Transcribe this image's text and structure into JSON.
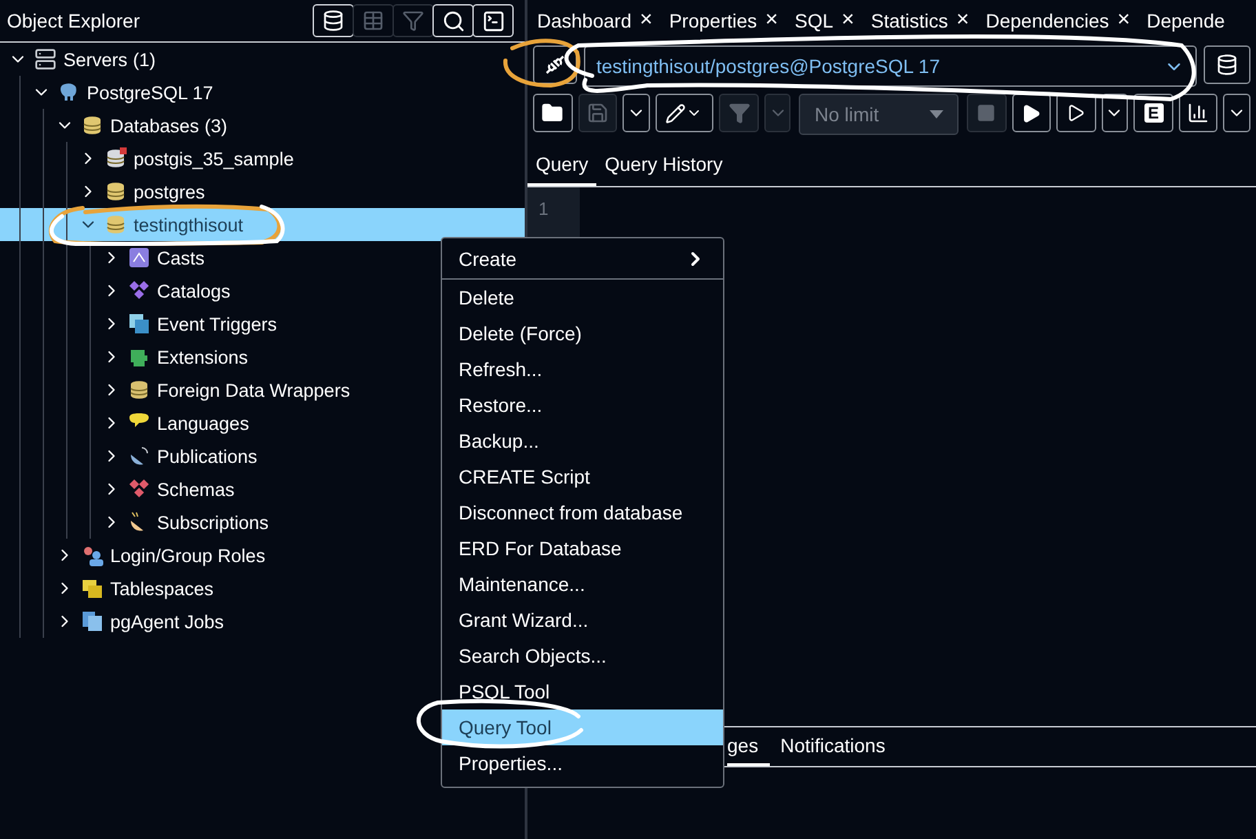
{
  "object_explorer": {
    "title": "Object Explorer",
    "tools": [
      {
        "kind": "query",
        "disabled": false
      },
      {
        "kind": "grid",
        "disabled": true
      },
      {
        "kind": "filter",
        "disabled": true
      },
      {
        "kind": "search",
        "disabled": false
      },
      {
        "kind": "terminal",
        "disabled": false
      }
    ],
    "tree": [
      {
        "label": "Servers",
        "count": "(1)",
        "kind": "servers",
        "expanded": true,
        "selected": false,
        "children": [
          {
            "label": "PostgreSQL 17",
            "kind": "server",
            "expanded": true,
            "selected": false,
            "children": [
              {
                "label": "Databases",
                "count": "(3)",
                "kind": "databases",
                "expanded": true,
                "selected": false,
                "children": [
                  {
                    "label": "postgis_35_sample",
                    "kind": "database_off",
                    "expanded": false,
                    "selected": false
                  },
                  {
                    "label": "postgres",
                    "kind": "database",
                    "expanded": false,
                    "selected": false
                  },
                  {
                    "label": "testingthisout",
                    "kind": "database",
                    "expanded": true,
                    "selected": true,
                    "children": [
                      {
                        "label": "Casts",
                        "kind": "casts",
                        "expanded": false,
                        "selected": false
                      },
                      {
                        "label": "Catalogs",
                        "kind": "catalogs",
                        "expanded": false,
                        "selected": false
                      },
                      {
                        "label": "Event Triggers",
                        "kind": "triggers",
                        "expanded": false,
                        "selected": false
                      },
                      {
                        "label": "Extensions",
                        "kind": "extensions",
                        "expanded": false,
                        "selected": false
                      },
                      {
                        "label": "Foreign Data Wrappers",
                        "kind": "fdw",
                        "expanded": false,
                        "selected": false
                      },
                      {
                        "label": "Languages",
                        "kind": "languages",
                        "expanded": false,
                        "selected": false
                      },
                      {
                        "label": "Publications",
                        "kind": "publications",
                        "expanded": false,
                        "selected": false
                      },
                      {
                        "label": "Schemas",
                        "kind": "schemas",
                        "expanded": false,
                        "selected": false
                      },
                      {
                        "label": "Subscriptions",
                        "kind": "subscriptions",
                        "expanded": false,
                        "selected": false
                      }
                    ]
                  }
                ]
              },
              {
                "label": "Login/Group Roles",
                "kind": "roles",
                "expanded": false,
                "selected": false
              },
              {
                "label": "Tablespaces",
                "kind": "tablespaces",
                "expanded": false,
                "selected": false
              },
              {
                "label": "pgAgent Jobs",
                "kind": "jobs",
                "expanded": false,
                "selected": false
              }
            ]
          }
        ]
      }
    ]
  },
  "tabs": [
    {
      "label": "Dashboard",
      "close": "×"
    },
    {
      "label": "Properties",
      "close": "×"
    },
    {
      "label": "SQL",
      "close": "×"
    },
    {
      "label": "Statistics",
      "close": "×"
    },
    {
      "label": "Dependencies",
      "close": "×"
    },
    {
      "label": "Depende"
    }
  ],
  "connection": {
    "value": "testingthisout/postgres@PostgreSQL 17"
  },
  "toolbar": [
    {
      "kind": "open",
      "disabled": false
    },
    {
      "kind": "save",
      "disabled": true
    },
    {
      "kind": "caret",
      "disabled": false
    },
    {
      "kind": "edit",
      "disabled": false
    },
    {
      "kind": "filter",
      "disabled": true
    },
    {
      "kind": "caret",
      "disabled": true
    },
    {
      "kind": "limit",
      "label": "No limit",
      "disabled": true
    },
    {
      "kind": "stop",
      "disabled": true
    },
    {
      "kind": "run",
      "disabled": false
    },
    {
      "kind": "run_script",
      "disabled": false
    },
    {
      "kind": "caret",
      "disabled": false
    },
    {
      "kind": "explain",
      "label": "E",
      "disabled": false
    },
    {
      "kind": "chart",
      "disabled": false
    },
    {
      "kind": "caret",
      "disabled": false
    }
  ],
  "query_tabs": [
    {
      "label": "Query",
      "selected": true
    },
    {
      "label": "Query History",
      "selected": false
    }
  ],
  "editor": {
    "line_numbers": [
      "1"
    ]
  },
  "output_tabs": [
    {
      "label": "ges",
      "selected": true
    },
    {
      "label": "Notifications",
      "selected": false
    }
  ],
  "context_menu": [
    {
      "label": "Create",
      "submenu": true,
      "selected": false
    },
    {
      "label": "Delete",
      "selected": false
    },
    {
      "label": "Delete (Force)",
      "selected": false
    },
    {
      "label": "Refresh...",
      "selected": false
    },
    {
      "label": "Restore...",
      "selected": false
    },
    {
      "label": "Backup...",
      "selected": false
    },
    {
      "label": "CREATE Script",
      "selected": false
    },
    {
      "label": "Disconnect from database",
      "selected": false
    },
    {
      "label": "ERD For Database",
      "selected": false
    },
    {
      "label": "Maintenance...",
      "selected": false
    },
    {
      "label": "Grant Wizard...",
      "selected": false
    },
    {
      "label": "Search Objects...",
      "selected": false
    },
    {
      "label": "PSQL Tool",
      "selected": false
    },
    {
      "label": "Query Tool",
      "selected": true
    },
    {
      "label": "Properties...",
      "selected": false
    }
  ],
  "annotations": [
    {
      "color": "#e8a33a"
    },
    {
      "color": "#ffffff"
    },
    {
      "color": "#e8a33a"
    },
    {
      "color": "#ffffff"
    },
    {
      "color": "#ffffff"
    }
  ]
}
